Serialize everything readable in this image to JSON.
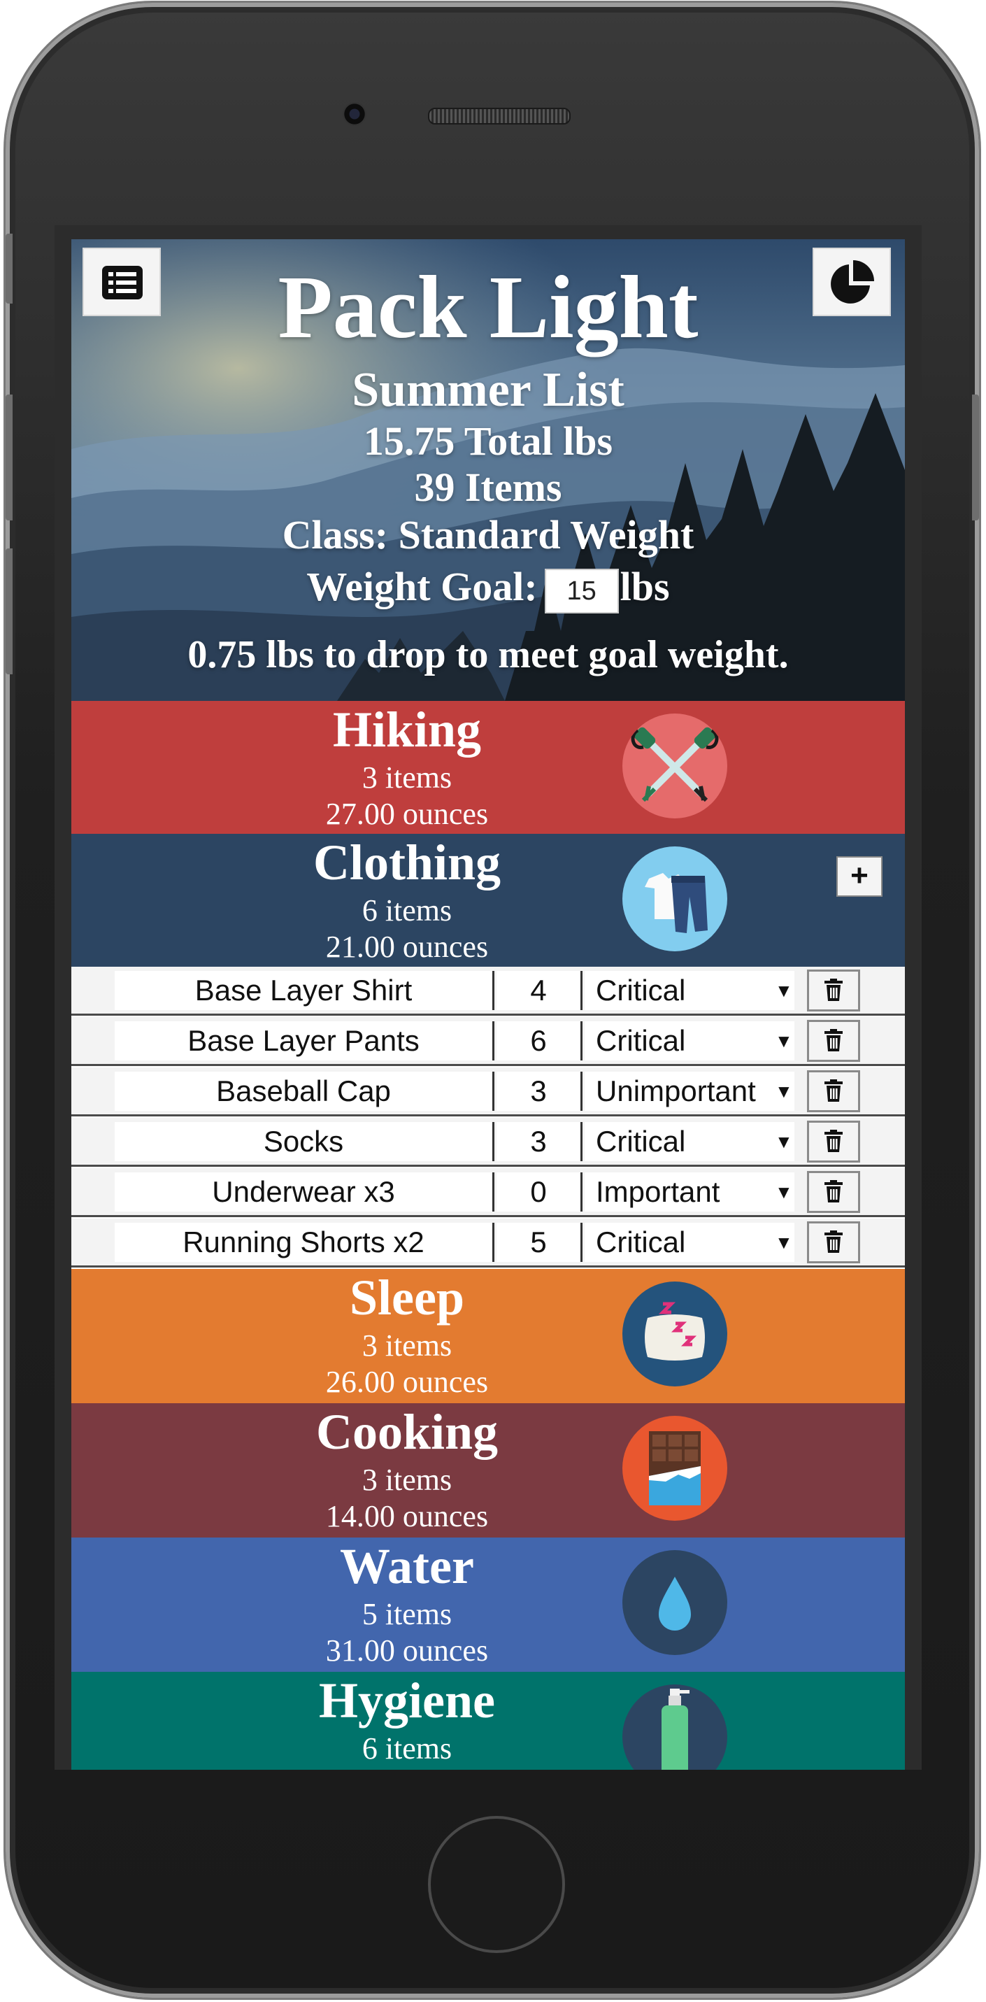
{
  "app": {
    "title": "Pack Light",
    "list_name": "Summer List",
    "total_weight": "15.75 Total lbs",
    "item_count": "39 Items",
    "weight_class": "Class: Standard Weight",
    "goal_label": "Weight Goal:",
    "goal_value": "15",
    "goal_unit": "lbs",
    "drop_message": "0.75 lbs to drop to meet goal weight."
  },
  "icons": {
    "menu": "list-icon",
    "chart": "pie-chart-icon",
    "add": "+",
    "delete": "trash-icon"
  },
  "categories": [
    {
      "name": "Hiking",
      "items": "3 items",
      "weight": "27.00 ounces",
      "color": "#bf3e3d",
      "icon": "trekking-poles-icon"
    },
    {
      "name": "Clothing",
      "items": "6 items",
      "weight": "21.00 ounces",
      "color": "#2c4562",
      "icon": "clothes-icon"
    },
    {
      "name": "Sleep",
      "items": "3 items",
      "weight": "26.00 ounces",
      "color": "#e37b30",
      "icon": "pillow-icon"
    },
    {
      "name": "Cooking",
      "items": "3 items",
      "weight": "14.00 ounces",
      "color": "#7b3a41",
      "icon": "chocolate-icon"
    },
    {
      "name": "Water",
      "items": "5 items",
      "weight": "31.00 ounces",
      "color": "#4266ad",
      "icon": "water-drop-icon"
    },
    {
      "name": "Hygiene",
      "items": "6 items",
      "weight": "",
      "color": "#00736b",
      "icon": "soap-bottle-icon"
    }
  ],
  "clothing_items": [
    {
      "name": "Base Layer Shirt",
      "weight": "4",
      "importance": "Critical"
    },
    {
      "name": "Base Layer Pants",
      "weight": "6",
      "importance": "Critical"
    },
    {
      "name": "Baseball Cap",
      "weight": "3",
      "importance": "Unimportant"
    },
    {
      "name": "Socks",
      "weight": "3",
      "importance": "Critical"
    },
    {
      "name": "Underwear x3",
      "weight": "0",
      "importance": "Important"
    },
    {
      "name": "Running Shorts x2",
      "weight": "5",
      "importance": "Critical"
    }
  ]
}
